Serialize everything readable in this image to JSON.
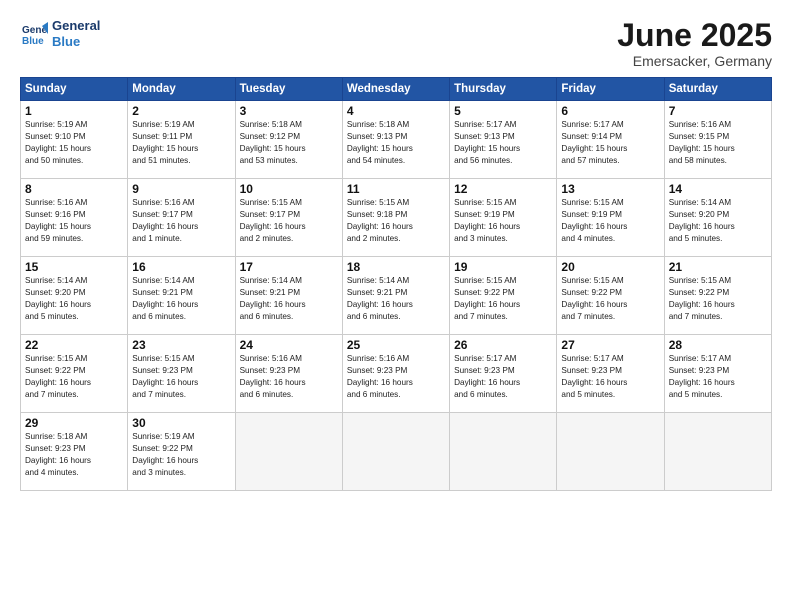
{
  "logo": {
    "line1": "General",
    "line2": "Blue"
  },
  "title": "June 2025",
  "location": "Emersacker, Germany",
  "days_header": [
    "Sunday",
    "Monday",
    "Tuesday",
    "Wednesday",
    "Thursday",
    "Friday",
    "Saturday"
  ],
  "weeks": [
    [
      {
        "day": "1",
        "info": "Sunrise: 5:19 AM\nSunset: 9:10 PM\nDaylight: 15 hours\nand 50 minutes."
      },
      {
        "day": "2",
        "info": "Sunrise: 5:19 AM\nSunset: 9:11 PM\nDaylight: 15 hours\nand 51 minutes."
      },
      {
        "day": "3",
        "info": "Sunrise: 5:18 AM\nSunset: 9:12 PM\nDaylight: 15 hours\nand 53 minutes."
      },
      {
        "day": "4",
        "info": "Sunrise: 5:18 AM\nSunset: 9:13 PM\nDaylight: 15 hours\nand 54 minutes."
      },
      {
        "day": "5",
        "info": "Sunrise: 5:17 AM\nSunset: 9:13 PM\nDaylight: 15 hours\nand 56 minutes."
      },
      {
        "day": "6",
        "info": "Sunrise: 5:17 AM\nSunset: 9:14 PM\nDaylight: 15 hours\nand 57 minutes."
      },
      {
        "day": "7",
        "info": "Sunrise: 5:16 AM\nSunset: 9:15 PM\nDaylight: 15 hours\nand 58 minutes."
      }
    ],
    [
      {
        "day": "8",
        "info": "Sunrise: 5:16 AM\nSunset: 9:16 PM\nDaylight: 15 hours\nand 59 minutes."
      },
      {
        "day": "9",
        "info": "Sunrise: 5:16 AM\nSunset: 9:17 PM\nDaylight: 16 hours\nand 1 minute."
      },
      {
        "day": "10",
        "info": "Sunrise: 5:15 AM\nSunset: 9:17 PM\nDaylight: 16 hours\nand 2 minutes."
      },
      {
        "day": "11",
        "info": "Sunrise: 5:15 AM\nSunset: 9:18 PM\nDaylight: 16 hours\nand 2 minutes."
      },
      {
        "day": "12",
        "info": "Sunrise: 5:15 AM\nSunset: 9:19 PM\nDaylight: 16 hours\nand 3 minutes."
      },
      {
        "day": "13",
        "info": "Sunrise: 5:15 AM\nSunset: 9:19 PM\nDaylight: 16 hours\nand 4 minutes."
      },
      {
        "day": "14",
        "info": "Sunrise: 5:14 AM\nSunset: 9:20 PM\nDaylight: 16 hours\nand 5 minutes."
      }
    ],
    [
      {
        "day": "15",
        "info": "Sunrise: 5:14 AM\nSunset: 9:20 PM\nDaylight: 16 hours\nand 5 minutes."
      },
      {
        "day": "16",
        "info": "Sunrise: 5:14 AM\nSunset: 9:21 PM\nDaylight: 16 hours\nand 6 minutes."
      },
      {
        "day": "17",
        "info": "Sunrise: 5:14 AM\nSunset: 9:21 PM\nDaylight: 16 hours\nand 6 minutes."
      },
      {
        "day": "18",
        "info": "Sunrise: 5:14 AM\nSunset: 9:21 PM\nDaylight: 16 hours\nand 6 minutes."
      },
      {
        "day": "19",
        "info": "Sunrise: 5:15 AM\nSunset: 9:22 PM\nDaylight: 16 hours\nand 7 minutes."
      },
      {
        "day": "20",
        "info": "Sunrise: 5:15 AM\nSunset: 9:22 PM\nDaylight: 16 hours\nand 7 minutes."
      },
      {
        "day": "21",
        "info": "Sunrise: 5:15 AM\nSunset: 9:22 PM\nDaylight: 16 hours\nand 7 minutes."
      }
    ],
    [
      {
        "day": "22",
        "info": "Sunrise: 5:15 AM\nSunset: 9:22 PM\nDaylight: 16 hours\nand 7 minutes."
      },
      {
        "day": "23",
        "info": "Sunrise: 5:15 AM\nSunset: 9:23 PM\nDaylight: 16 hours\nand 7 minutes."
      },
      {
        "day": "24",
        "info": "Sunrise: 5:16 AM\nSunset: 9:23 PM\nDaylight: 16 hours\nand 6 minutes."
      },
      {
        "day": "25",
        "info": "Sunrise: 5:16 AM\nSunset: 9:23 PM\nDaylight: 16 hours\nand 6 minutes."
      },
      {
        "day": "26",
        "info": "Sunrise: 5:17 AM\nSunset: 9:23 PM\nDaylight: 16 hours\nand 6 minutes."
      },
      {
        "day": "27",
        "info": "Sunrise: 5:17 AM\nSunset: 9:23 PM\nDaylight: 16 hours\nand 5 minutes."
      },
      {
        "day": "28",
        "info": "Sunrise: 5:17 AM\nSunset: 9:23 PM\nDaylight: 16 hours\nand 5 minutes."
      }
    ],
    [
      {
        "day": "29",
        "info": "Sunrise: 5:18 AM\nSunset: 9:23 PM\nDaylight: 16 hours\nand 4 minutes."
      },
      {
        "day": "30",
        "info": "Sunrise: 5:19 AM\nSunset: 9:22 PM\nDaylight: 16 hours\nand 3 minutes."
      },
      {
        "day": "",
        "info": ""
      },
      {
        "day": "",
        "info": ""
      },
      {
        "day": "",
        "info": ""
      },
      {
        "day": "",
        "info": ""
      },
      {
        "day": "",
        "info": ""
      }
    ]
  ]
}
